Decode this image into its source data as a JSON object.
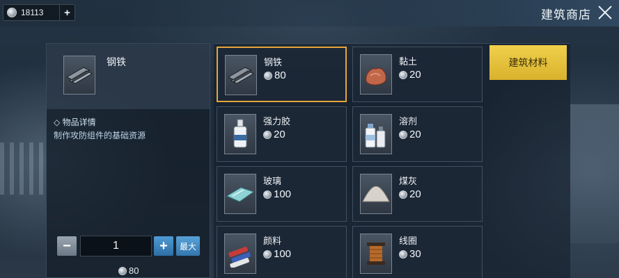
{
  "header": {
    "currency_amount": "18113",
    "add_label": "+",
    "shop_title": "建筑商店"
  },
  "detail": {
    "item_name": "钢铁",
    "desc_title": "◇ 物品详情",
    "desc_text": "制作攻防组件的基础资源",
    "minus_label": "−",
    "plus_label": "+",
    "quantity": "1",
    "max_label": "最大",
    "total_price": "80"
  },
  "tabs": [
    {
      "label": "建筑材料",
      "active": true
    }
  ],
  "items": [
    {
      "name": "钢铁",
      "price": "80",
      "icon": "steel-bars-icon",
      "selected": true
    },
    {
      "name": "黏土",
      "price": "20",
      "icon": "clay-icon"
    },
    {
      "name": "强力胶",
      "price": "20",
      "icon": "glue-bottle-icon"
    },
    {
      "name": "溶剂",
      "price": "20",
      "icon": "solvent-bottles-icon"
    },
    {
      "name": "玻璃",
      "price": "100",
      "icon": "glass-pane-icon"
    },
    {
      "name": "煤灰",
      "price": "20",
      "icon": "coal-ash-icon"
    },
    {
      "name": "颜料",
      "price": "100",
      "icon": "paint-tubes-icon"
    },
    {
      "name": "线圈",
      "price": "30",
      "icon": "wire-spool-icon"
    }
  ],
  "colors": {
    "accent_selected": "#e8a53a",
    "tab_active": "#f0d04c",
    "button_blue": "#3377ad"
  }
}
